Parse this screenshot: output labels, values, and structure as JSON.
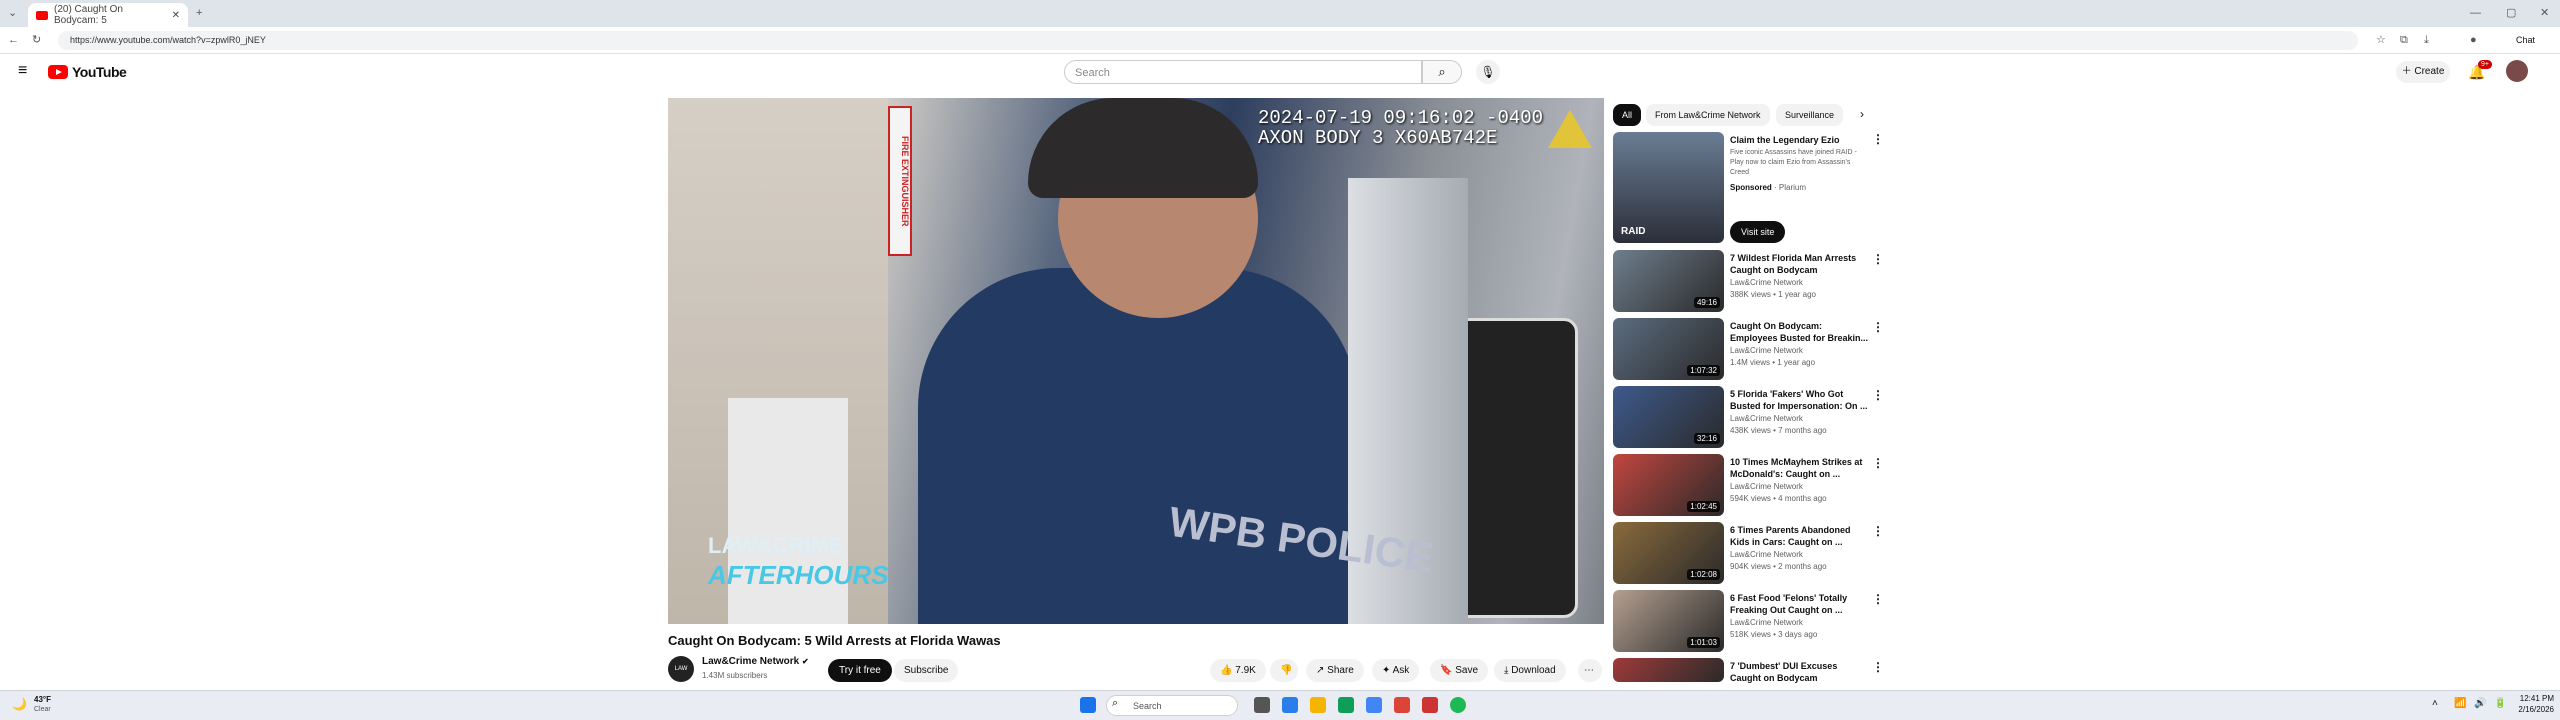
{
  "browser": {
    "tab_title": "(20) Caught On Bodycam: 5",
    "url": "https://www.youtube.com/watch?v=zpwlR0_jNEY",
    "new_tab": "+",
    "profile_label": "Chat"
  },
  "header": {
    "logo_text": "YouTube",
    "search_placeholder": "Search",
    "create_label": "Create",
    "notification_count": "9+"
  },
  "player": {
    "timestamp_line1": "2024-07-19 09:16:02 -0400",
    "timestamp_line2": "AXON BODY 3 X60AB742E",
    "watermark_line1": "LAW&CRIME",
    "watermark_line2": "AFTERHOURS",
    "sign_text": "FIRE EXTINGUISHER",
    "uniform_text": "WPB POLICE"
  },
  "video": {
    "title": "Caught On Bodycam: 5 Wild Arrests at Florida Wawas",
    "channel": "Law&Crime Network",
    "subscribers": "1.43M subscribers",
    "avatar_text": "LAW CRIME",
    "try_free": "Try it free",
    "subscribe": "Subscribe",
    "likes": "7.9K",
    "share": "Share",
    "ask": "Ask",
    "save": "Save",
    "download": "Download"
  },
  "chips": [
    "All",
    "From Law&Crime Network",
    "Surveillance"
  ],
  "sponsored": {
    "title": "Claim the Legendary Ezio",
    "desc": "Five iconic Assassins have joined RAID - Play now to claim Ezio from Assassin's Creed",
    "sponsored_label": "Sponsored",
    "advertiser": "Plarium",
    "cta": "Visit site",
    "thumb_text": "RAID"
  },
  "recommendations": [
    {
      "title": "7 Wildest Florida Man Arrests Caught on Bodycam",
      "channel": "Law&Crime Network",
      "meta": "388K views • 1 year ago",
      "duration": "49:16",
      "color": "#6f7e8e"
    },
    {
      "title": "Caught On Bodycam: Employees Busted for Breakin...",
      "channel": "Law&Crime Network",
      "meta": "1.4M views • 1 year ago",
      "duration": "1:07:32",
      "color": "#5c6c80"
    },
    {
      "title": "5 Florida 'Fakers' Who Got Busted for Impersonation: On ...",
      "channel": "Law&Crime Network",
      "meta": "438K views • 7 months ago",
      "duration": "32:16",
      "color": "#3e5a8c"
    },
    {
      "title": "10 Times McMayhem Strikes at McDonald's: Caught on ...",
      "channel": "Law&Crime Network",
      "meta": "594K views • 4 months ago",
      "duration": "1:02:45",
      "color": "#c2463f"
    },
    {
      "title": "6 Times Parents Abandoned Kids in Cars: Caught on ...",
      "channel": "Law&Crime Network",
      "meta": "904K views • 2 months ago",
      "duration": "1:02:08",
      "color": "#8a6a3c"
    },
    {
      "title": "6 Fast Food 'Felons' Totally Freaking Out Caught on ...",
      "channel": "Law&Crime Network",
      "meta": "518K views • 3 days ago",
      "duration": "1:01:03",
      "color": "#b5a090"
    },
    {
      "title": "7 'Dumbest' DUI Excuses Caught on Bodycam",
      "channel": "",
      "meta": "",
      "duration": "",
      "color": "#a03a3a"
    }
  ],
  "taskbar": {
    "weather_temp": "43°F",
    "weather_desc": "Clear",
    "search_label": "Search",
    "time": "12:41 PM",
    "date": "2/16/2026"
  }
}
